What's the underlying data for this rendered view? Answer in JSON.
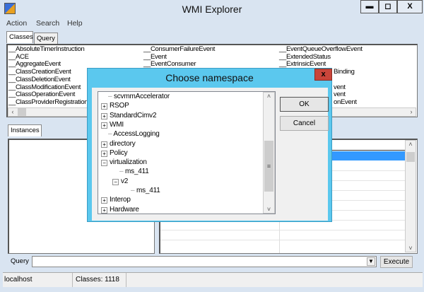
{
  "window": {
    "title": "WMI Explorer",
    "minimize": "▬",
    "maximize": "◻",
    "close": "X"
  },
  "menu": [
    "Action",
    "Search",
    "Help"
  ],
  "tabs": [
    "Classes",
    "Query"
  ],
  "classes": {
    "col1": [
      "__AbsoluteTimerInstruction",
      "__ACE",
      "__AggregateEvent",
      "__ClassCreationEvent",
      "__ClassDeletionEvent",
      "__ClassModificationEvent",
      "__ClassOperationEvent",
      "__ClassProviderRegistration"
    ],
    "col2": [
      "__ConsumerFailureEvent",
      "__Event",
      "__EventConsumer"
    ],
    "col3": [
      "__EventQueueOverflowEvent",
      "__ExtendedStatus",
      "__ExtrinsicEvent"
    ],
    "col3_partial": [
      "Binding",
      "",
      "vent",
      "vent",
      "onEvent"
    ]
  },
  "instances_tab": "Instances",
  "query": {
    "label": "Query",
    "value": "",
    "execute": "Execute"
  },
  "status": {
    "host": "localhost",
    "classes": "Classes: 1118"
  },
  "dialog": {
    "title": "Choose namespace",
    "close": "x",
    "ok": "OK",
    "cancel": "Cancel",
    "tree": [
      {
        "label": "scvmmAccelerator",
        "level": 1,
        "toggle": ""
      },
      {
        "label": "RSOP",
        "level": 1,
        "toggle": "+"
      },
      {
        "label": "StandardCimv2",
        "level": 1,
        "toggle": "+"
      },
      {
        "label": "WMI",
        "level": 1,
        "toggle": "+"
      },
      {
        "label": "AccessLogging",
        "level": 1,
        "toggle": ""
      },
      {
        "label": "directory",
        "level": 1,
        "toggle": "+"
      },
      {
        "label": "Policy",
        "level": 1,
        "toggle": "+"
      },
      {
        "label": "virtualization",
        "level": 1,
        "toggle": "-"
      },
      {
        "label": "ms_411",
        "level": 2,
        "toggle": ""
      },
      {
        "label": "v2",
        "level": 2,
        "toggle": "-"
      },
      {
        "label": "ms_411",
        "level": 3,
        "toggle": ""
      },
      {
        "label": "Interop",
        "level": 1,
        "toggle": "+"
      },
      {
        "label": "Hardware",
        "level": 1,
        "toggle": "+"
      }
    ]
  },
  "colors": {
    "dialog_frame": "#5bc8ee",
    "close_red": "#c9453a",
    "selection": "#3399ff"
  }
}
